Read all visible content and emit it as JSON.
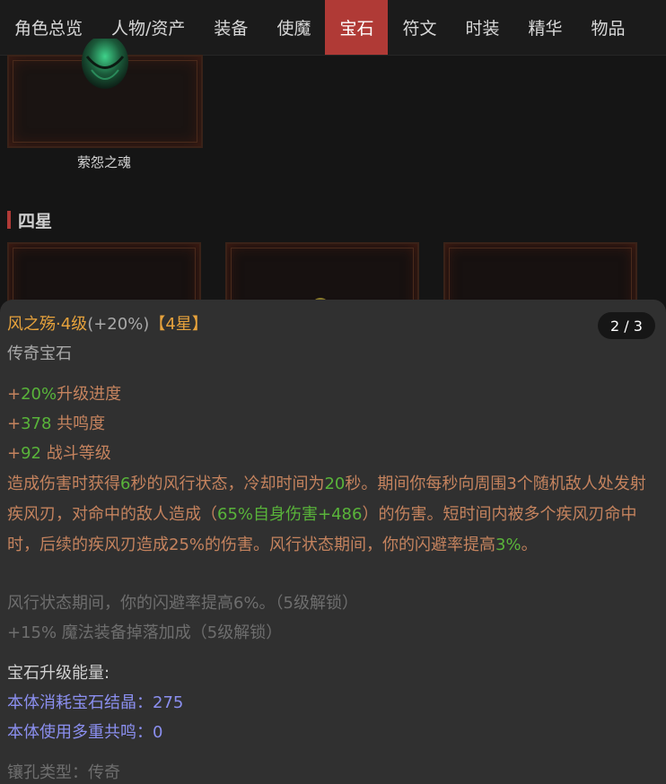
{
  "nav": {
    "tabs": [
      {
        "label": "角色总览"
      },
      {
        "label": "人物/资产"
      },
      {
        "label": "装备"
      },
      {
        "label": "使魔"
      },
      {
        "label": "宝石"
      },
      {
        "label": "符文"
      },
      {
        "label": "时装"
      },
      {
        "label": "精华"
      },
      {
        "label": "物品"
      }
    ],
    "active_index": 4,
    "active_color": "#b03a36"
  },
  "gems_above": {
    "item_name": "萦怨之魂"
  },
  "section": {
    "title": "四星",
    "accent": "#b03a36"
  },
  "detail": {
    "name": "风之殇·4级",
    "bonus": "(+20%)",
    "star_badge": "【4星】",
    "type": "传奇宝石",
    "pager": "2 / 3",
    "stats": [
      {
        "plus": "+",
        "value": "20%",
        "label": "升级进度"
      },
      {
        "plus": "+",
        "value": "378",
        "label": " 共鸣度"
      },
      {
        "plus": "+",
        "value": "92",
        "label": " 战斗等级"
      }
    ],
    "desc": {
      "p1": "造成伤害时获得",
      "v1": "6",
      "p2": "秒的风行状态，冷却时间为",
      "v2": "20",
      "p3": "秒。期间你每秒向周围3个随机敌人处发射疾风刃，对命中的敌人造成（",
      "v3": "65%自身伤害+486",
      "p4": "）的伤害。短时间内被多个疾风刃命中时，后续的疾风刃造成25%的伤害。风行状态期间，你的闪避率提高",
      "v4": "3%",
      "p5": "。"
    },
    "locked": [
      "风行状态期间，你的闪避率提高6%。（5级解锁）",
      "+15% 魔法装备掉落加成（5级解锁）"
    ],
    "upgrade_title": "宝石升级能量:",
    "crystal_label": "本体消耗宝石结晶：",
    "crystal_value": "275",
    "resonance_label": "本体使用多重共鸣：",
    "resonance_value": "0",
    "socket": "镶孔类型：传奇"
  },
  "colors": {
    "name": "#e6a23c",
    "green": "#59b43a",
    "desc": "#c5835e",
    "blue": "#8b8ff0",
    "locked": "#6e6e6e"
  }
}
